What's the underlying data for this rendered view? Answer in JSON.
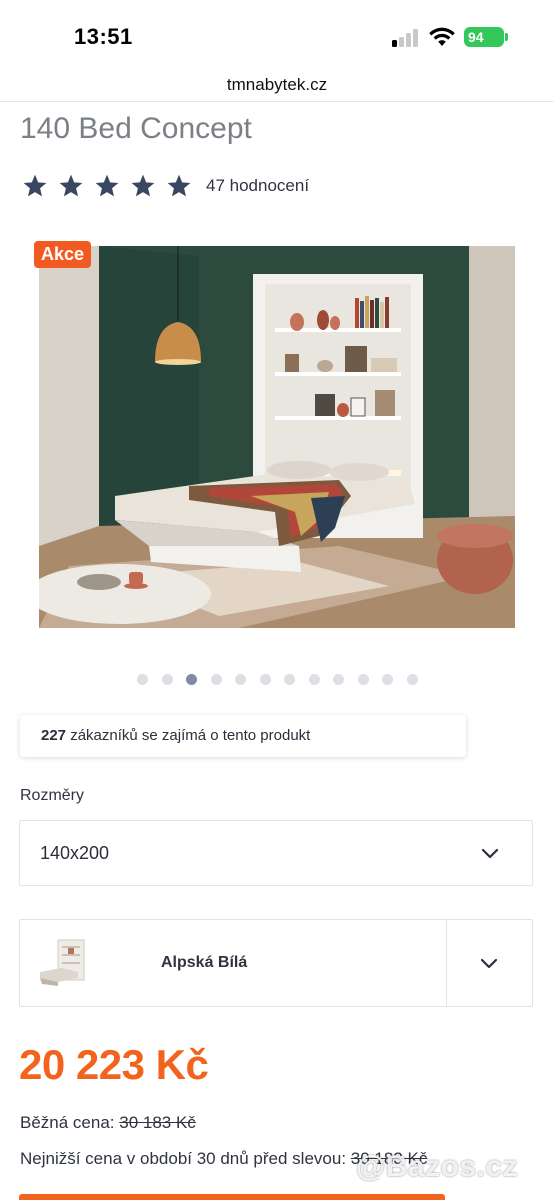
{
  "status_bar": {
    "time": "13:51",
    "battery": "94"
  },
  "browser": {
    "url": "tmnabytek.cz"
  },
  "product": {
    "title": "140 Bed Concept",
    "rating_stars": 5,
    "rating_count_text": "47 hodnocení",
    "badge": "Akce",
    "gallery_total": 12,
    "gallery_active_index": 2
  },
  "interest": {
    "count": "227",
    "text": " zákazníků se zajímá o tento produkt"
  },
  "dimensions": {
    "label": "Rozměry",
    "selected": "140x200"
  },
  "color": {
    "selected": "Alpská Bílá"
  },
  "pricing": {
    "price": "20 223 Kč",
    "normal_label": "Běžná cena: ",
    "normal_value": "30 183 Kč",
    "lowest_label": "Nejnižší cena v období 30 dnů před slevou: ",
    "lowest_value": "30 183 Kč"
  },
  "watermark": "@Bazos.cz",
  "colors": {
    "accent": "#f2641e",
    "badge": "#f25a22",
    "star": "#3a4760",
    "dot_active": "#7f8aa5",
    "wall": "#2c4a3e"
  }
}
